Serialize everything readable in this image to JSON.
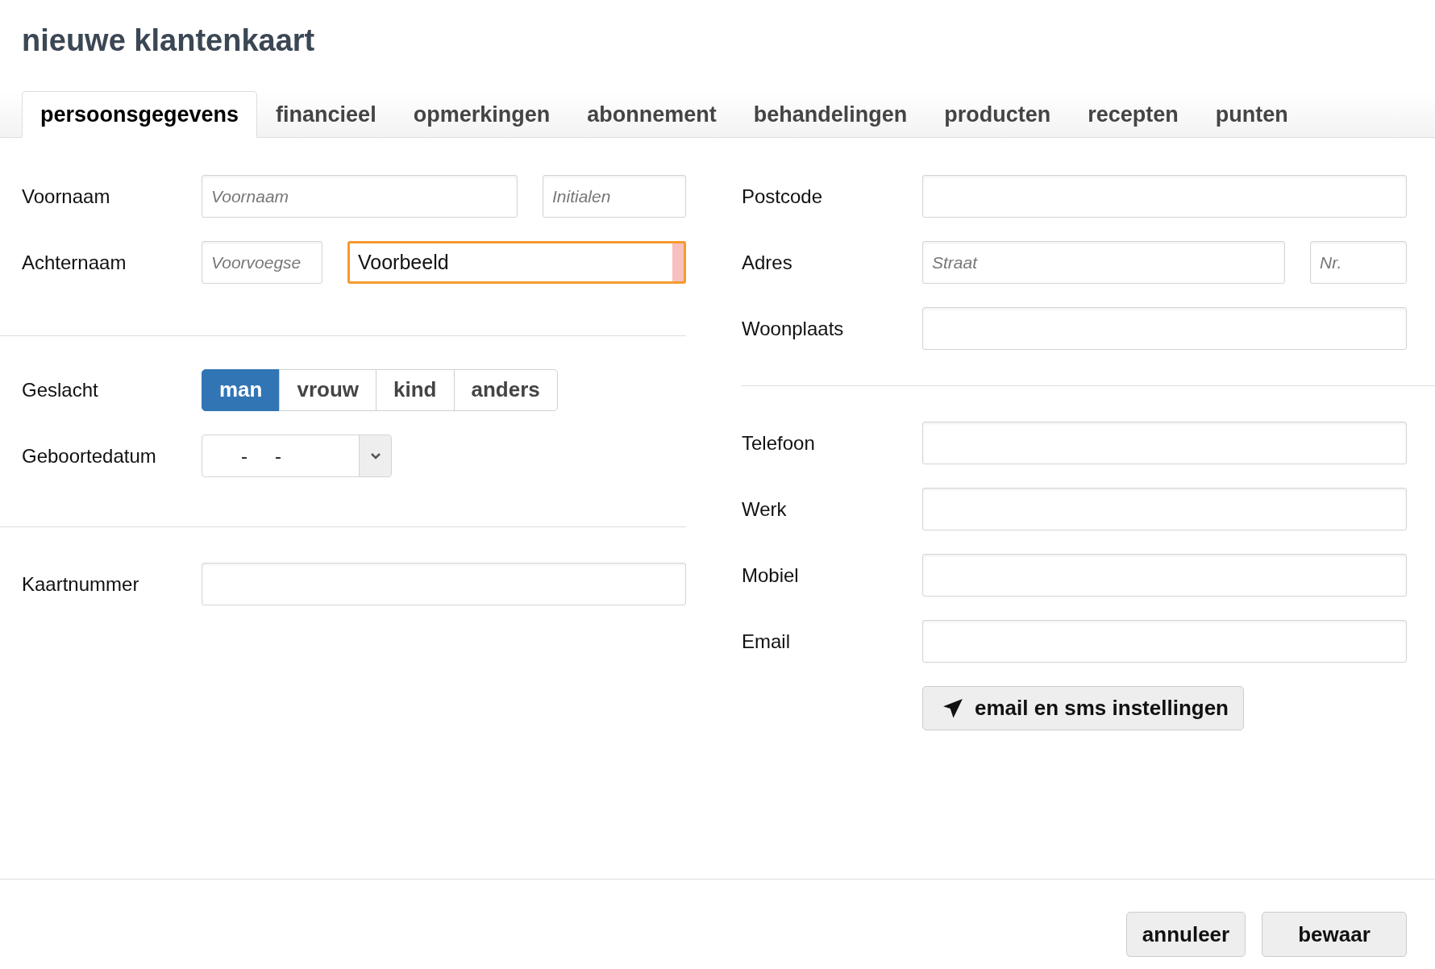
{
  "title": "nieuwe klantenkaart",
  "tabs": [
    {
      "label": "persoonsgegevens",
      "selected": true
    },
    {
      "label": "financieel",
      "selected": false
    },
    {
      "label": "opmerkingen",
      "selected": false
    },
    {
      "label": "abonnement",
      "selected": false
    },
    {
      "label": "behandelingen",
      "selected": false
    },
    {
      "label": "producten",
      "selected": false
    },
    {
      "label": "recepten",
      "selected": false
    },
    {
      "label": "punten",
      "selected": false
    }
  ],
  "left_sections": [
    {
      "rows": [
        {
          "kind": "input",
          "label": "Voornaam",
          "fields": [
            {
              "placeholder": "Voornaam"
            },
            {
              "placeholder": "Initialen"
            }
          ]
        },
        {
          "kind": "input",
          "label": "Achternaam",
          "fields": [
            {
              "placeholder": "Voorvoegse"
            },
            {
              "value": "Voorbeeld",
              "focused": true
            }
          ]
        }
      ]
    },
    {
      "rows": [
        {
          "kind": "segmented",
          "label": "Geslacht",
          "options": [
            {
              "label": "man",
              "selected": true
            },
            {
              "label": "vrouw",
              "selected": false
            },
            {
              "label": "kind",
              "selected": false
            },
            {
              "label": "anders",
              "selected": false
            }
          ]
        },
        {
          "kind": "date",
          "label": "Geboortedatum",
          "separators": [
            "-",
            "-"
          ]
        }
      ]
    },
    {
      "rows": [
        {
          "kind": "input",
          "label": "Kaartnummer"
        }
      ]
    }
  ],
  "right_sections": [
    {
      "rows": [
        {
          "kind": "input",
          "label": "Postcode"
        },
        {
          "kind": "input",
          "label": "Adres",
          "fields": [
            {
              "placeholder": "Straat"
            },
            {
              "placeholder": "Nr."
            }
          ]
        },
        {
          "kind": "input",
          "label": "Woonplaats"
        }
      ]
    },
    {
      "rows": [
        {
          "kind": "input",
          "label": "Telefoon"
        },
        {
          "kind": "input",
          "label": "Werk"
        },
        {
          "kind": "input",
          "label": "Mobiel"
        },
        {
          "kind": "input",
          "label": "Email"
        },
        {
          "kind": "button",
          "label": "email en sms instellingen"
        }
      ]
    }
  ],
  "footer_buttons": [
    "annuleer",
    "bewaar"
  ]
}
